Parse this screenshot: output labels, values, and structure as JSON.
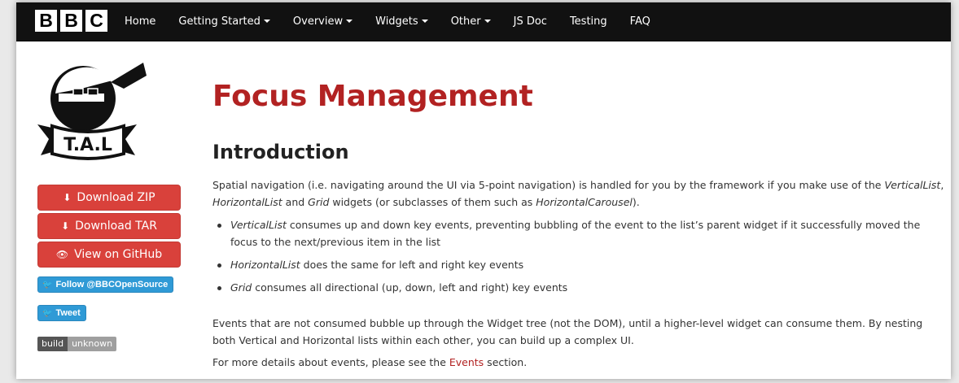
{
  "brand": {
    "letters": [
      "B",
      "B",
      "C"
    ]
  },
  "nav": {
    "items": [
      {
        "label": "Home",
        "dropdown": false
      },
      {
        "label": "Getting Started",
        "dropdown": true
      },
      {
        "label": "Overview",
        "dropdown": true
      },
      {
        "label": "Widgets",
        "dropdown": true
      },
      {
        "label": "Other",
        "dropdown": true
      },
      {
        "label": "JS Doc",
        "dropdown": false
      },
      {
        "label": "Testing",
        "dropdown": false
      },
      {
        "label": "FAQ",
        "dropdown": false
      }
    ]
  },
  "sidebar": {
    "logo_text": "T.A.L",
    "download_zip": "Download ZIP",
    "download_tar": "Download TAR",
    "view_github": "View on GitHub",
    "follow": "Follow @BBCOpenSource",
    "tweet": "Tweet",
    "badge_left": "build",
    "badge_right": "unknown"
  },
  "main": {
    "title": "Focus Management",
    "section": "Introduction",
    "intro": {
      "before": "Spatial navigation (i.e. navigating around the UI via 5-point navigation) is handled for you by the framework if you make use of the ",
      "em1": "VerticalList",
      "comma": ", ",
      "em2": "HorizontalList",
      "and": " and ",
      "em3": "Grid",
      "middle": " widgets (or subclasses of them such as ",
      "em4": "HorizontalCarousel",
      "after": ")."
    },
    "bullets": [
      {
        "em": "VerticalList",
        "text": " consumes up and down key events, preventing bubbling of the event to the list’s parent widget if it successfully moved the focus to the next/previous item in the list"
      },
      {
        "em": "HorizontalList",
        "text": " does the same for left and right key events"
      },
      {
        "em": "Grid",
        "text": " consumes all directional (up, down, left and right) key events"
      }
    ],
    "para2": "Events that are not consumed bubble up through the Widget tree (not the DOM), until a higher-level widget can consume them. By nesting both Vertical and Horizontal lists within each other, you can build up a complex UI.",
    "para3": {
      "before": "For more details about events, please see the ",
      "link": "Events",
      "after": " section."
    }
  },
  "colors": {
    "navbar": "#111111",
    "accent_red": "#b22222",
    "button_red": "#d9413b",
    "twitter_blue": "#2f9ad6"
  }
}
